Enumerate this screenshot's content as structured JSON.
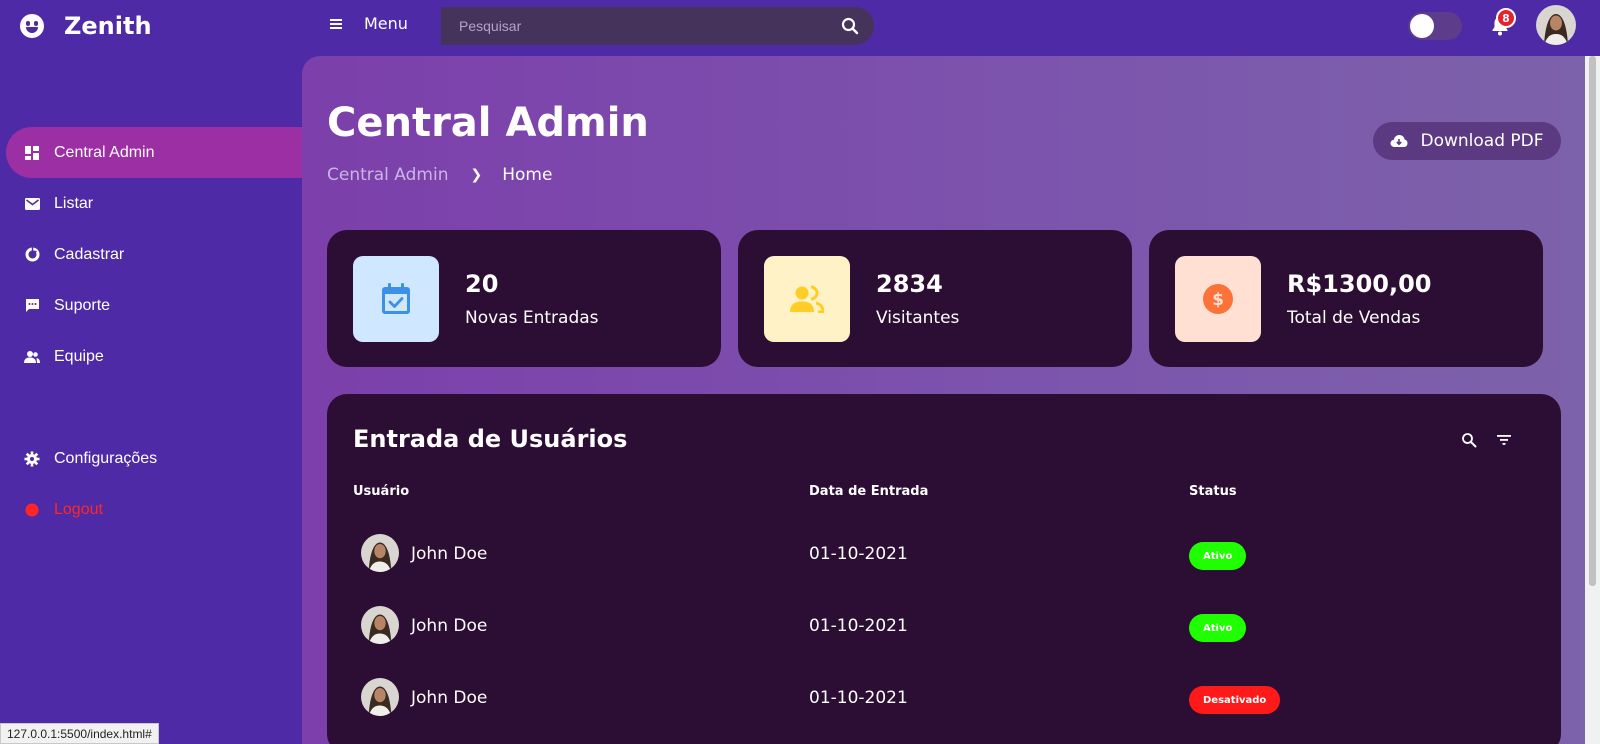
{
  "app": {
    "name": "Zenith"
  },
  "navbar": {
    "menu_label": "Menu",
    "search_placeholder": "Pesquisar",
    "notification_count": "8"
  },
  "sidebar": {
    "items": [
      {
        "label": "Central Admin",
        "icon": "dashboard-icon",
        "active": true
      },
      {
        "label": "Listar",
        "icon": "mail-icon"
      },
      {
        "label": "Cadastrar",
        "icon": "pie-chart-icon"
      },
      {
        "label": "Suporte",
        "icon": "chat-icon"
      },
      {
        "label": "Equipe",
        "icon": "group-icon"
      },
      {
        "label": "Configurações",
        "icon": "gear-icon"
      },
      {
        "label": "Logout",
        "icon": "logout-icon"
      }
    ]
  },
  "header": {
    "title": "Central Admin",
    "breadcrumb": [
      "Central Admin",
      "Home"
    ],
    "download_label": "Download PDF"
  },
  "cards": [
    {
      "value": "20",
      "label": "Novas Entradas",
      "icon": "calendar-check-icon",
      "box_color": "#cfe8ff",
      "icon_color": "#3c91e6"
    },
    {
      "value": "2834",
      "label": "Visitantes",
      "icon": "people-icon",
      "box_color": "#fff2c6",
      "icon_color": "#ffce26"
    },
    {
      "value": "R$1300,00",
      "label": "Total de Vendas",
      "icon": "dollar-circle-icon",
      "box_color": "#ffe0d3",
      "icon_color": "#fd7238"
    }
  ],
  "table": {
    "title": "Entrada de Usuários",
    "columns": [
      "Usuário",
      "Data de Entrada",
      "Status"
    ],
    "rows": [
      {
        "user": "John Doe",
        "date": "01-10-2021",
        "status": "Ativo",
        "status_color": "#1fff00"
      },
      {
        "user": "John Doe",
        "date": "01-10-2021",
        "status": "Ativo",
        "status_color": "#1fff00"
      },
      {
        "user": "John Doe",
        "date": "01-10-2021",
        "status": "Desativado",
        "status_color": "#ff1a1a"
      }
    ]
  },
  "browser_status": {
    "url": "127.0.0.1:5500/index.html#"
  }
}
